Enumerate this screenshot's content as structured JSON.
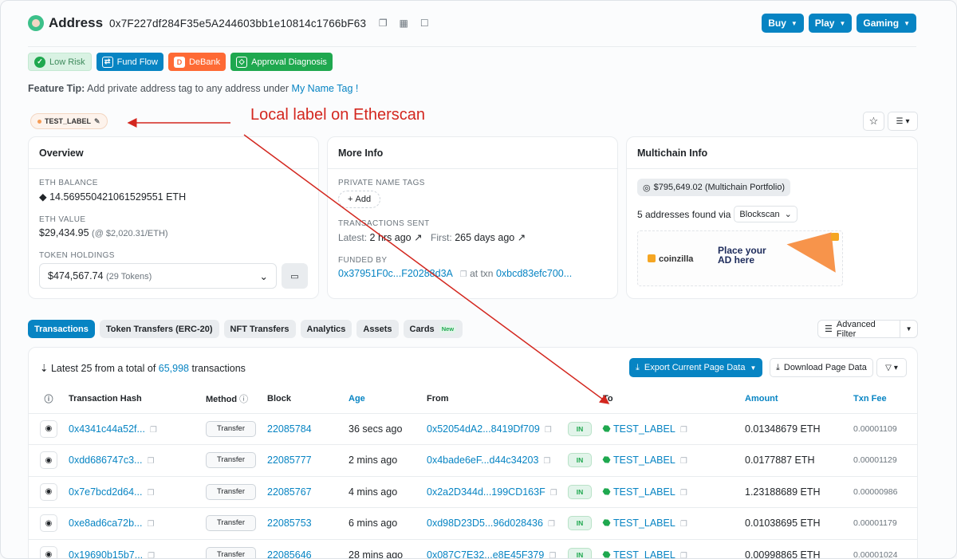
{
  "header": {
    "title": "Address",
    "address": "0x7F227df284F35e5A244603bb1e10814c1766bF63",
    "menus": [
      "Buy",
      "Play",
      "Gaming"
    ]
  },
  "badges": {
    "risk": "Low Risk",
    "flow": "Fund Flow",
    "debank": "DeBank",
    "diag": "Approval Diagnosis"
  },
  "tip": {
    "prefix": "Feature Tip:",
    "text": "Add private address tag to any address under",
    "link": "My Name Tag !"
  },
  "label_chip": "TEST_LABEL",
  "annotation": "Local label on Etherscan",
  "overview": {
    "title": "Overview",
    "eth_balance_cap": "ETH BALANCE",
    "eth_balance": "14.569550421061529551 ETH",
    "eth_value_cap": "ETH VALUE",
    "eth_value": "$29,434.95",
    "eth_value_rate": "(@ $2,020.31/ETH)",
    "token_cap": "TOKEN HOLDINGS",
    "token_value": "$474,567.74",
    "token_count": "(29 Tokens)"
  },
  "more_info": {
    "title": "More Info",
    "tags_cap": "PRIVATE NAME TAGS",
    "add": "Add",
    "sent_cap": "TRANSACTIONS SENT",
    "latest_label": "Latest:",
    "latest": "2 hrs ago",
    "first_label": "First:",
    "first": "265 days ago",
    "funded_cap": "FUNDED BY",
    "funded_addr": "0x37951F0c...F20288d3A",
    "at_txn": "at txn",
    "funded_txn": "0xbcd83efc700..."
  },
  "multichain": {
    "title": "Multichain Info",
    "portfolio": "$795,649.02 (Multichain Portfolio)",
    "found": "5 addresses found via",
    "via": "Blockscan",
    "ad_brand": "coinzilla",
    "ad_line1": "Place your",
    "ad_line2": "AD here"
  },
  "tabs": [
    "Transactions",
    "Token Transfers (ERC-20)",
    "NFT Transfers",
    "Analytics",
    "Assets",
    "Cards"
  ],
  "tab_new": "New",
  "advanced_filter": "Advanced Filter",
  "table": {
    "summary_prefix": "Latest 25 from a total of",
    "summary_count": "65,998",
    "summary_suffix": "transactions",
    "export": "Export Current Page Data",
    "download": "Download Page Data",
    "headers": [
      "Transaction Hash",
      "Method",
      "Block",
      "Age",
      "From",
      "To",
      "Amount",
      "Txn Fee"
    ],
    "rows": [
      {
        "hash": "0x4341c44a52f...",
        "method": "Transfer",
        "block": "22085784",
        "age": "36 secs ago",
        "from": "0x52054dA2...8419Df709",
        "dir": "IN",
        "to": "TEST_LABEL",
        "amount": "0.01348679 ETH",
        "fee": "0.00001109"
      },
      {
        "hash": "0xdd686747c3...",
        "method": "Transfer",
        "block": "22085777",
        "age": "2 mins ago",
        "from": "0x4bade6eF...d44c34203",
        "dir": "IN",
        "to": "TEST_LABEL",
        "amount": "0.0177887 ETH",
        "fee": "0.00001129"
      },
      {
        "hash": "0x7e7bcd2d64...",
        "method": "Transfer",
        "block": "22085767",
        "age": "4 mins ago",
        "from": "0x2a2D344d...199CD163F",
        "dir": "IN",
        "to": "TEST_LABEL",
        "amount": "1.23188689 ETH",
        "fee": "0.00000986"
      },
      {
        "hash": "0xe8ad6ca72b...",
        "method": "Transfer",
        "block": "22085753",
        "age": "6 mins ago",
        "from": "0xd98D23D5...96d028436",
        "dir": "IN",
        "to": "TEST_LABEL",
        "amount": "0.01038695 ETH",
        "fee": "0.00001179"
      },
      {
        "hash": "0x19690b15b7...",
        "method": "Transfer",
        "block": "22085646",
        "age": "28 mins ago",
        "from": "0x087C7E32...e8E45F379",
        "dir": "IN",
        "to": "TEST_LABEL",
        "amount": "0.00998865 ETH",
        "fee": "0.00001024"
      }
    ]
  }
}
